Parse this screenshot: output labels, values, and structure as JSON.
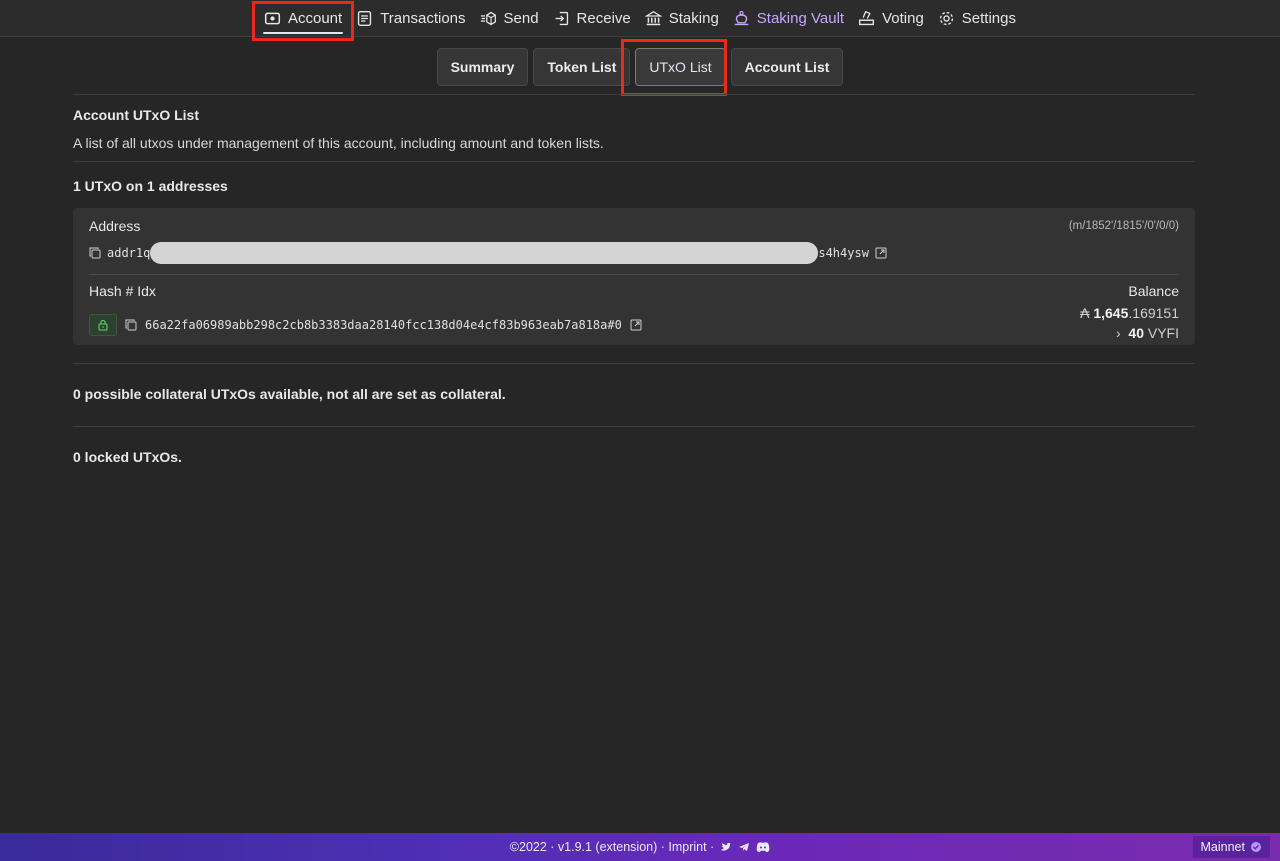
{
  "nav": {
    "items": [
      {
        "label": "Account",
        "icon": "wallet-icon"
      },
      {
        "label": "Transactions",
        "icon": "list-icon"
      },
      {
        "label": "Send",
        "icon": "send-icon"
      },
      {
        "label": "Receive",
        "icon": "receive-icon"
      },
      {
        "label": "Staking",
        "icon": "bank-icon"
      },
      {
        "label": "Staking Vault",
        "icon": "vault-icon"
      },
      {
        "label": "Voting",
        "icon": "ballot-icon"
      },
      {
        "label": "Settings",
        "icon": "gear-icon"
      }
    ],
    "active": "Account"
  },
  "subtabs": [
    "Summary",
    "Token List",
    "UTxO List",
    "Account List"
  ],
  "page": {
    "title": "Account UTxO List",
    "description": "A list of all utxos under management of this account, including amount and token lists.",
    "count_line": "1 UTxO on 1 addresses"
  },
  "card": {
    "address_label": "Address",
    "derivation_path": "(m/1852'/1815'/0'/0/0)",
    "address_prefix": "addr1q",
    "address_suffix": "s4h4ysw",
    "hash_label": "Hash # Idx",
    "balance_label": "Balance",
    "hash": "66a22fa06989abb298c2cb8b3383daa28140fcc138d04e4cf83b963eab7a818a#0",
    "ada_symbol": "₳",
    "ada_whole": "1,645",
    "ada_fraction": ".169151",
    "token_arrow": "›",
    "token_amount": "40",
    "token_name": "VYFI"
  },
  "collateral_text": "0 possible collateral UTxOs available, not all are set as collateral.",
  "locked_text": "0 locked UTxOs.",
  "footer": {
    "text": "©2022 · v1.9.1 (extension) · Imprint ·",
    "network": "Mainnet"
  },
  "colors": {
    "highlight": "#e8291c",
    "vault": "#c8a6ff",
    "footer_start": "#3a2a9a",
    "footer_end": "#7a2cae"
  }
}
